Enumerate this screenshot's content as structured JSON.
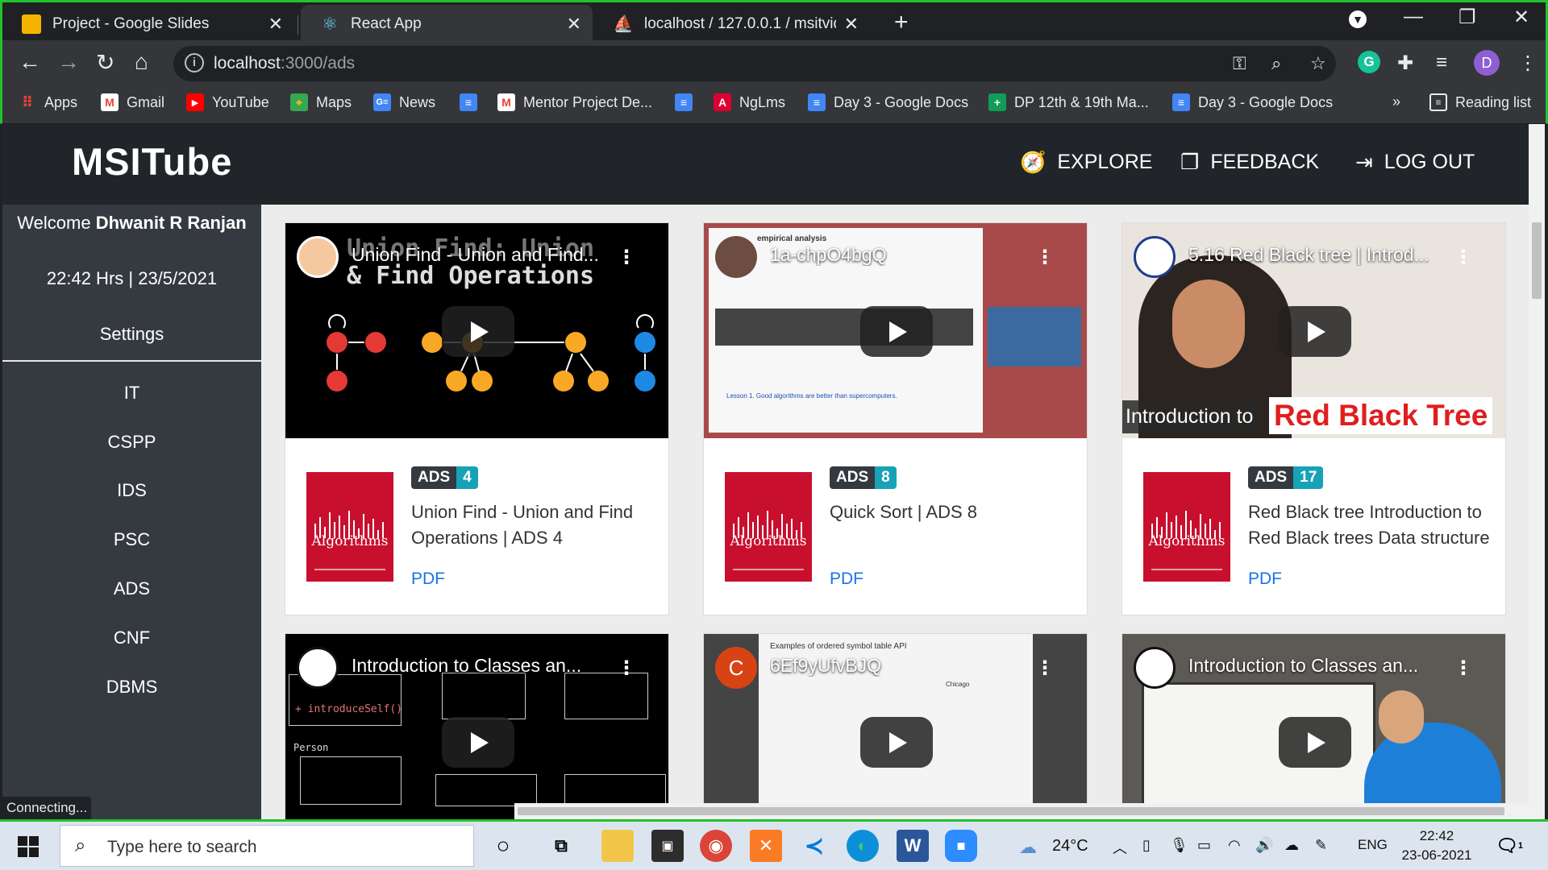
{
  "browser": {
    "tabs": [
      {
        "title": "Project - Google Slides",
        "icon": "google-slides-icon"
      },
      {
        "title": "React App",
        "icon": "react-icon"
      },
      {
        "title": "localhost / 127.0.0.1 / msitvideo",
        "icon": "phpmyadmin-icon"
      }
    ],
    "url_host": "localhost",
    "url_path": ":3000/ads",
    "status_text": "Connecting..."
  },
  "bookmarks": [
    {
      "label": "Apps",
      "icon": "apps-grid-icon"
    },
    {
      "label": "Gmail",
      "icon": "gmail-icon"
    },
    {
      "label": "YouTube",
      "icon": "youtube-icon"
    },
    {
      "label": "Maps",
      "icon": "maps-icon"
    },
    {
      "label": "News",
      "icon": "news-icon"
    },
    {
      "label": "",
      "icon": "google-docs-icon"
    },
    {
      "label": "Mentor Project De...",
      "icon": "gmail-icon"
    },
    {
      "label": "",
      "icon": "google-docs-icon"
    },
    {
      "label": "NgLms",
      "icon": "angular-icon"
    },
    {
      "label": "Day 3 - Google Docs",
      "icon": "google-docs-icon"
    },
    {
      "label": "DP 12th & 19th Ma...",
      "icon": "google-sheets-icon"
    },
    {
      "label": "Day 3 - Google Docs",
      "icon": "google-docs-icon"
    }
  ],
  "bookmarks_more": "»",
  "reading_list": "Reading list",
  "app": {
    "brand": "MSITube",
    "nav": [
      {
        "label": "EXPLORE",
        "icon": "compass-icon"
      },
      {
        "label": "FEEDBACK",
        "icon": "copy-icon"
      },
      {
        "label": "LOG OUT",
        "icon": "logout-icon"
      }
    ],
    "welcome_prefix": "Welcome",
    "user_name": "Dhwanit R Ranjan",
    "datetime": "22:42 Hrs | 23/5/2021",
    "settings": "Settings",
    "subjects": [
      "IT",
      "CSPP",
      "IDS",
      "PSC",
      "ADS",
      "CNF",
      "DBMS"
    ]
  },
  "videos": [
    {
      "video_title": "Union Find - Union and Find...",
      "badge_subject": "ADS",
      "badge_num": "4",
      "title": "Union Find - Union and Find Operations | ADS 4",
      "link": "PDF",
      "thumb_caption_1": "Union Find: Union",
      "thumb_caption_2": "& Find Operations"
    },
    {
      "video_title": "1a-chpO4bgQ",
      "badge_subject": "ADS",
      "badge_num": "8",
      "title": "Quick Sort | ADS 8",
      "link": "PDF",
      "thumb_caption_1": "empirical analysis",
      "thumb_caption_2": "Lesson 1.  Good algorithms are better than supercomputers."
    },
    {
      "video_title": "5.16 Red Black tree | Introd...",
      "badge_subject": "ADS",
      "badge_num": "17",
      "title": "Red Black tree Introduction to Red Black trees Data structure",
      "link": "PDF",
      "thumb_caption_1": "Introduction to",
      "thumb_caption_2": "Red Black Tree"
    },
    {
      "video_title": "Introduction to Classes an...",
      "thumb_caption_1": "Person",
      "thumb_caption_2": "+ introduceSelf()"
    },
    {
      "video_title": "6Ef9yUfvBJQ",
      "thumb_caption_1": "Examples of ordered symbol table API",
      "thumb_caption_2": "Chicago"
    },
    {
      "video_title": "Introduction to Classes an..."
    }
  ],
  "book_cover_title": "Algorithms",
  "taskbar": {
    "search_placeholder": "Type here to search",
    "weather": "24°C",
    "language": "ENG",
    "time": "22:42",
    "date": "23-06-2021",
    "notification_count": "1"
  },
  "colors": {
    "header": "#212529",
    "sidebar": "#343a40",
    "badge_num": "#17a2b8",
    "link": "#1a73e8",
    "window_border": "#22c22e"
  }
}
